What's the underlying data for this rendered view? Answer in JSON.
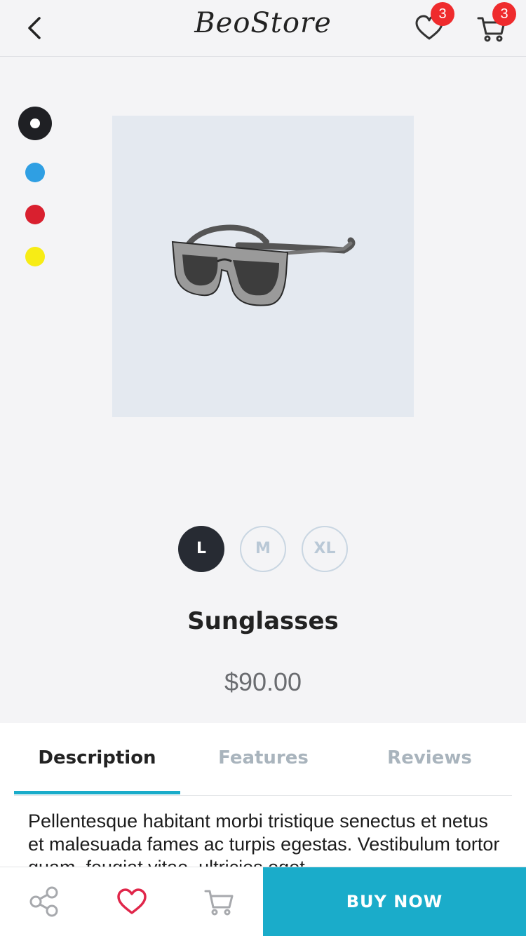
{
  "header": {
    "brand": "BeoStore",
    "wishlist_count": "3",
    "cart_count": "3"
  },
  "colors": {
    "options": [
      "#1f2024",
      "#2f9fe3",
      "#d9202f",
      "#f7ec15"
    ],
    "selected": "#1f2024",
    "accent": "#1aacca",
    "badge": "#ef2b2d"
  },
  "sizes": [
    {
      "label": "L",
      "selected": true
    },
    {
      "label": "M",
      "selected": false
    },
    {
      "label": "XL",
      "selected": false
    }
  ],
  "product": {
    "name": "Sunglasses",
    "price": "$90.00",
    "image_icon": "sunglasses-icon"
  },
  "tabs": [
    {
      "label": "Description",
      "active": true
    },
    {
      "label": "Features",
      "active": false
    },
    {
      "label": "Reviews",
      "active": false
    }
  ],
  "description": "Pellentesque habitant morbi tristique senectus et netus et malesuada fames ac turpis egestas. Vestibulum tortor quam, feugiat vitae, ultricies eget",
  "bottom_bar": {
    "buy_label": "BUY NOW",
    "icons": [
      "share-icon",
      "heart-icon",
      "cart-icon"
    ]
  }
}
